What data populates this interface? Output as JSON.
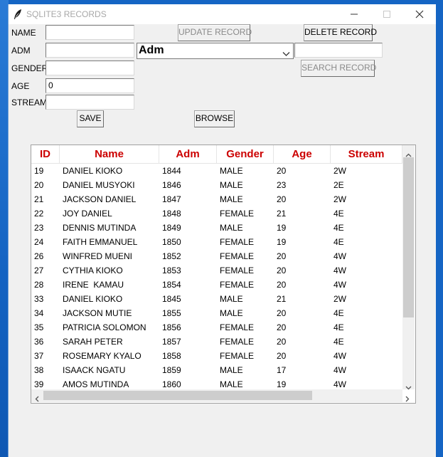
{
  "window": {
    "title": "SQLITE3 RECORDS",
    "icon": "feather-icon"
  },
  "form": {
    "name_label": "NAME",
    "adm_label": "ADM",
    "gender_label": "GENDER",
    "age_label": "AGE",
    "stream_label": "STREAM",
    "name_value": "",
    "adm_value": "",
    "gender_value": "",
    "age_value": "0",
    "stream_value": "",
    "search_value": ""
  },
  "buttons": {
    "update": "UPDATE RECORD",
    "delete": "DELETE RECORD",
    "search": "SEARCH RECORD",
    "save": "SAVE",
    "browse": "BROWSE"
  },
  "search_combo": {
    "selected": "Adm"
  },
  "table": {
    "columns": [
      "ID",
      "Name",
      "Adm",
      "Gender",
      "Age",
      "Stream"
    ],
    "rows": [
      [
        "19",
        "DANIEL KIOKO",
        "1844",
        "MALE",
        "20",
        "2W"
      ],
      [
        "20",
        "DANIEL MUSYOKI",
        "1846",
        "MALE",
        "23",
        "2E"
      ],
      [
        "21",
        "JACKSON DANIEL",
        "1847",
        "MALE",
        "20",
        "2W"
      ],
      [
        "22",
        "JOY DANIEL",
        "1848",
        "FEMALE",
        "21",
        "4E"
      ],
      [
        "23",
        "DENNIS MUTINDA",
        "1849",
        "MALE",
        "19",
        "4E"
      ],
      [
        "24",
        "FAITH EMMANUEL",
        "1850",
        "FEMALE",
        "19",
        "4E"
      ],
      [
        "26",
        "WINFRED MUENI",
        "1852",
        "FEMALE",
        "20",
        "4W"
      ],
      [
        "27",
        "CYTHIA KIOKO",
        "1853",
        "FEMALE",
        "20",
        "4W"
      ],
      [
        "28",
        "IRENE  KAMAU",
        "1854",
        "FEMALE",
        "20",
        "4W"
      ],
      [
        "33",
        "DANIEL KIOKO",
        "1845",
        "MALE",
        "21",
        "2W"
      ],
      [
        "34",
        "JACKSON MUTIE",
        "1855",
        "MALE",
        "20",
        "4E"
      ],
      [
        "35",
        "PATRICIA SOLOMON",
        "1856",
        "FEMALE",
        "20",
        "4E"
      ],
      [
        "36",
        "SARAH PETER",
        "1857",
        "FEMALE",
        "20",
        "4E"
      ],
      [
        "37",
        "ROSEMARY KYALO",
        "1858",
        "FEMALE",
        "20",
        "4W"
      ],
      [
        "38",
        "ISAACK NGATU",
        "1859",
        "MALE",
        "17",
        "4W"
      ],
      [
        "39",
        "AMOS MUTINDA",
        "1860",
        "MALE",
        "19",
        "4W"
      ]
    ]
  },
  "colors": {
    "header_text": "#cc0000",
    "taskbar_blue": "#1565c4"
  }
}
